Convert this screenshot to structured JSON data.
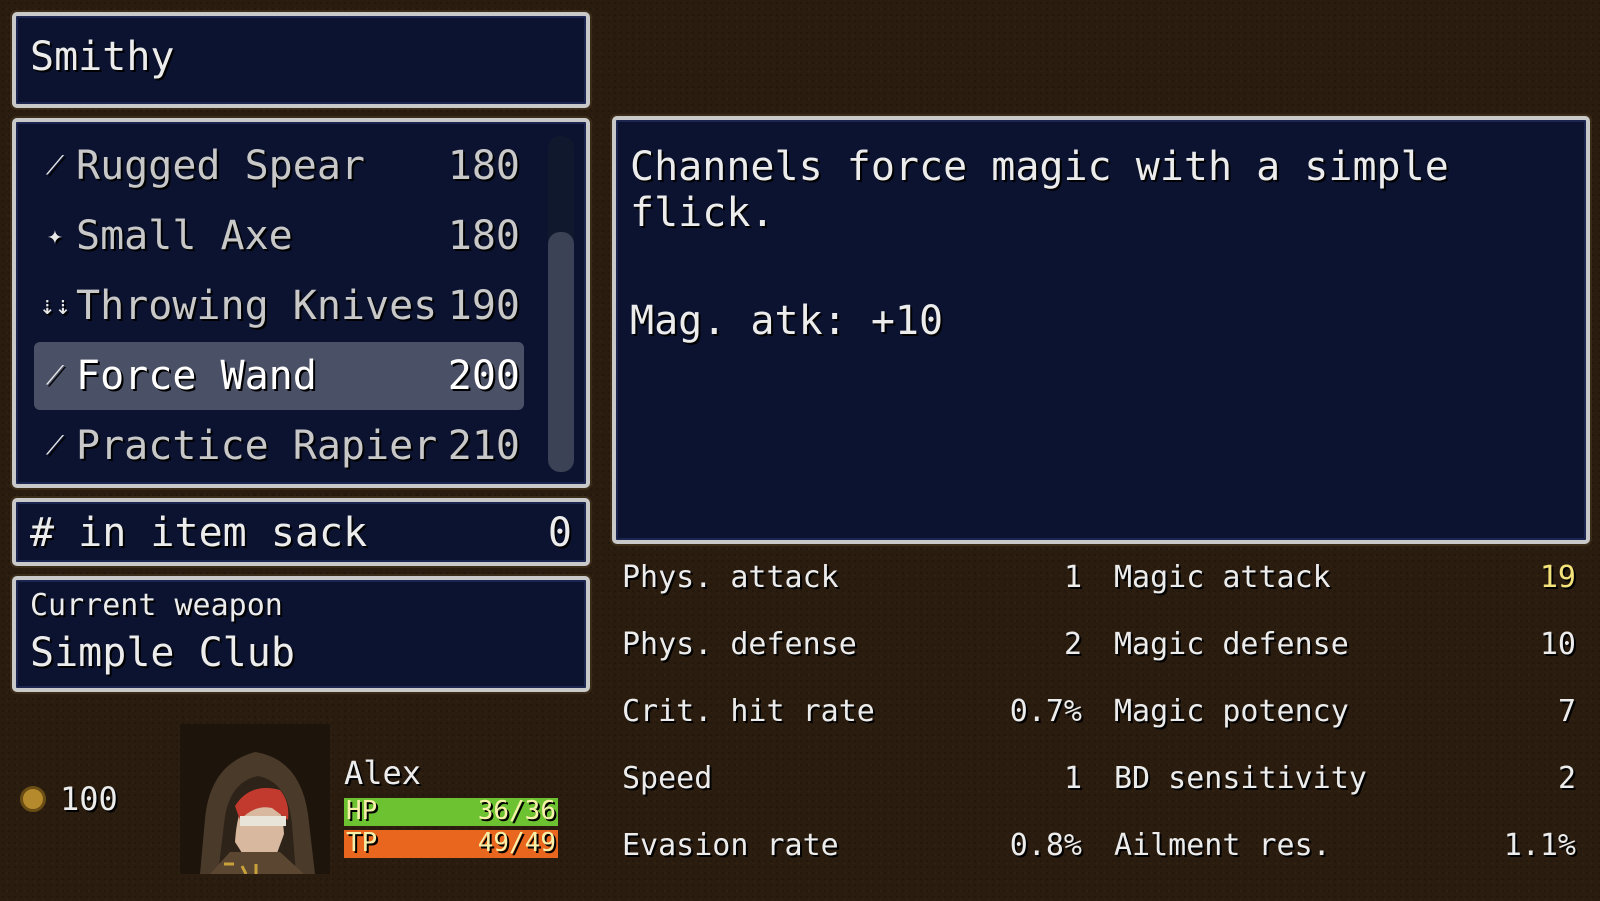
{
  "title": "Smithy",
  "colors": {
    "hp": "#6cc231",
    "tp": "#e8661d",
    "highlight": "#f4e27a"
  },
  "items": [
    {
      "icon": "spear-icon",
      "glyph": "⟋",
      "name": "Rugged Spear",
      "price": "180",
      "selected": false
    },
    {
      "icon": "axe-icon",
      "glyph": "✦",
      "name": "Small Axe",
      "price": "180",
      "selected": false
    },
    {
      "icon": "knives-icon",
      "glyph": "⇣⇣",
      "name": "Throwing Knives",
      "price": "190",
      "selected": false
    },
    {
      "icon": "wand-icon",
      "glyph": "⟋",
      "name": "Force Wand",
      "price": "200",
      "selected": true
    },
    {
      "icon": "rapier-icon",
      "glyph": "⟋",
      "name": "Practice Rapier",
      "price": "210",
      "selected": false
    }
  ],
  "sack": {
    "label": "# in item sack",
    "value": "0"
  },
  "current_weapon": {
    "label": "Current weapon",
    "value": "Simple Club"
  },
  "description": {
    "line1": "Channels force magic with a simple flick.",
    "line2": "Mag. atk: +10"
  },
  "stats_left": [
    {
      "label": "Phys. attack",
      "value": "1"
    },
    {
      "label": "Phys. defense",
      "value": "2"
    },
    {
      "label": "Crit. hit rate",
      "value": "0.7%"
    },
    {
      "label": "Speed",
      "value": "1"
    },
    {
      "label": "Evasion rate",
      "value": "0.8%"
    }
  ],
  "stats_right": [
    {
      "label": "Magic attack",
      "value": "19",
      "highlight": true
    },
    {
      "label": "Magic defense",
      "value": "10"
    },
    {
      "label": "Magic potency",
      "value": "7"
    },
    {
      "label": "BD sensitivity",
      "value": "2"
    },
    {
      "label": "Ailment res.",
      "value": "1.1%"
    }
  ],
  "gold": "100",
  "actor": {
    "name": "Alex",
    "hp_label": "HP",
    "hp_text": "36/36",
    "hp_fraction": 1.0,
    "tp_label": "TP",
    "tp_text": "49/49",
    "tp_fraction": 1.0
  }
}
